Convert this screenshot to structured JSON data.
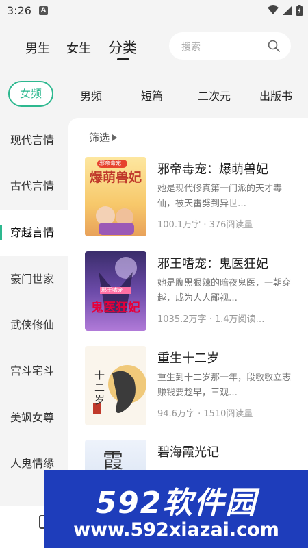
{
  "status_bar": {
    "time": "3:26",
    "notification_letter": "A"
  },
  "top_tabs": [
    {
      "label": "男生",
      "active": false
    },
    {
      "label": "女生",
      "active": false
    },
    {
      "label": "分类",
      "active": true
    }
  ],
  "search": {
    "placeholder": "搜索"
  },
  "categories": [
    "女频",
    "男频",
    "短篇",
    "二次元",
    "出版书"
  ],
  "active_category": "女频",
  "sidebar": {
    "items": [
      "现代言情",
      "古代言情",
      "穿越言情",
      "豪门世家",
      "武侠修仙",
      "宫斗宅斗",
      "美飒女尊",
      "人鬼情缘"
    ],
    "active": "穿越言情"
  },
  "filter_label": "筛选",
  "books": [
    {
      "title": "邪帝毒宠：爆萌兽妃",
      "description": "她是现代修真第一门派的天才毒仙，被天雷劈到异世…",
      "meta": "100.1万字 · 376阅读量",
      "cover_text": "爆萌兽妃",
      "cover_tag": "邪帝毒宠"
    },
    {
      "title": "邪王嗜宠：鬼医狂妃",
      "description": "她是腹黑狠辣的暗夜鬼医，一朝穿越，成为人人鄙视…",
      "meta": "1035.2万字 · 1.4万阅读…",
      "cover_text": "鬼医狂妃",
      "cover_tag": "邪王嗜宠"
    },
    {
      "title": "重生十二岁",
      "description": "重生到十二岁那一年，段敏敏立志赚钱要趁早，三观…",
      "meta": "94.6万字 · 1510阅读量",
      "cover_text": "十二岁"
    },
    {
      "title": "碧海霞光记",
      "description": "",
      "meta": "",
      "cover_text": "霞"
    }
  ],
  "watermark": {
    "line1": "592软件园",
    "line2": "www.592xiazai.com"
  },
  "colors": {
    "accent": "#2db88f",
    "watermark_bg": "#1e3dbb"
  }
}
